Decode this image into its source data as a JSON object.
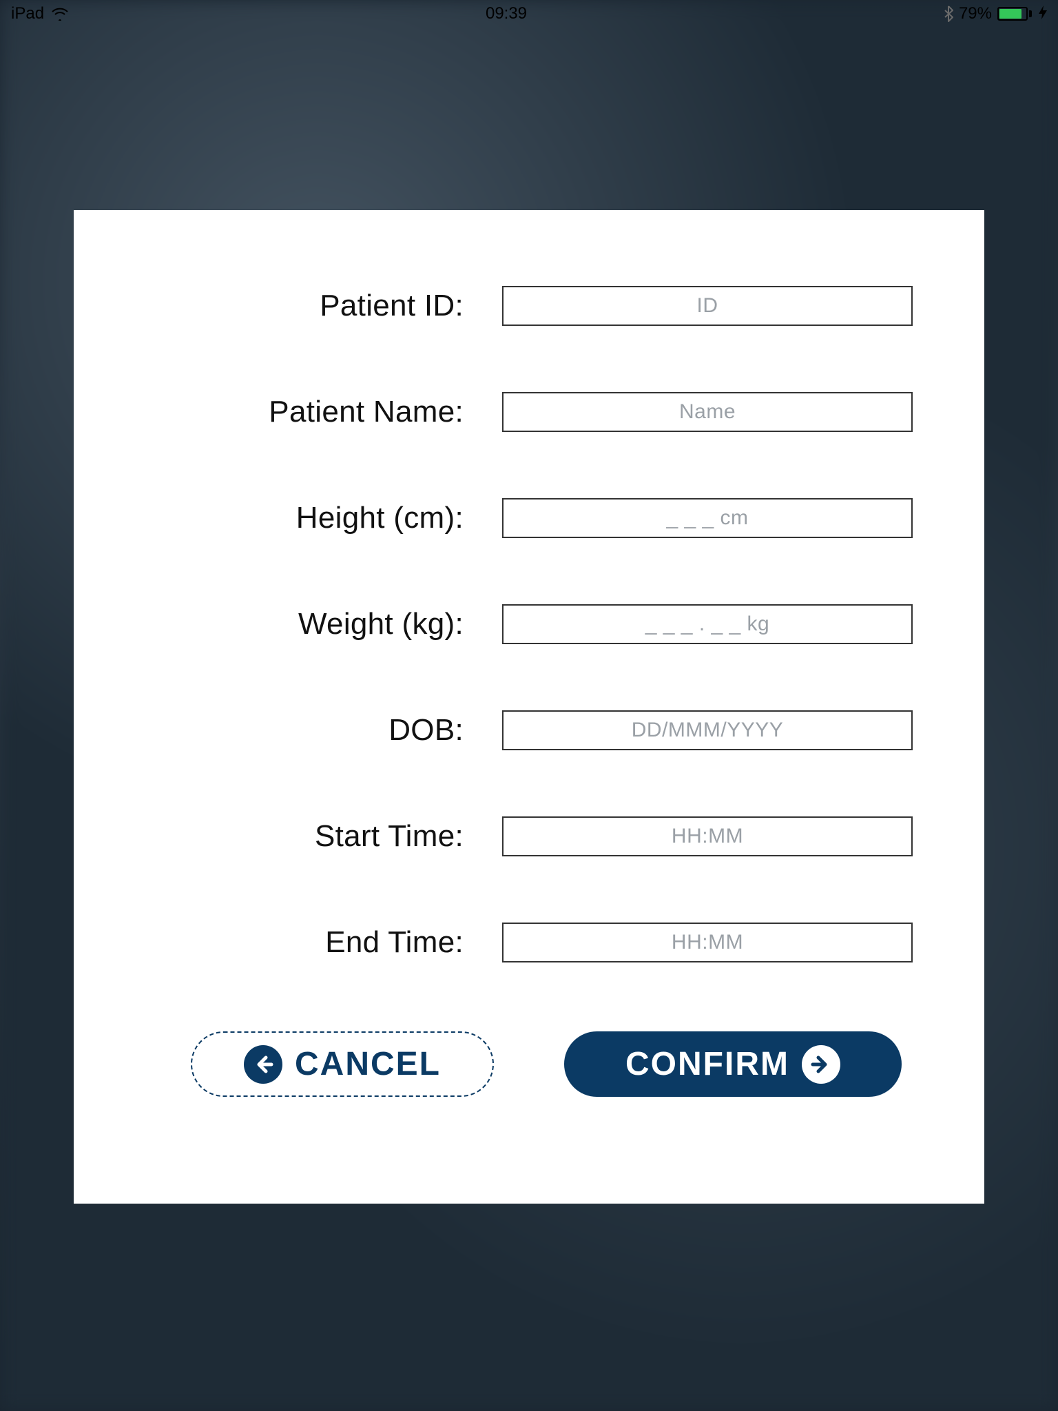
{
  "status_bar": {
    "device": "iPad",
    "time": "09:39",
    "battery_pct": "79%"
  },
  "form": {
    "fields": [
      {
        "label": "Patient ID:",
        "placeholder": "ID"
      },
      {
        "label": "Patient Name:",
        "placeholder": "Name"
      },
      {
        "label": "Height (cm):",
        "placeholder": "_ _ _ cm"
      },
      {
        "label": "Weight (kg):",
        "placeholder": "_ _ _ . _ _ kg"
      },
      {
        "label": "DOB:",
        "placeholder": "DD/MMM/YYYY"
      },
      {
        "label": "Start Time:",
        "placeholder": "HH:MM"
      },
      {
        "label": "End Time:",
        "placeholder": "HH:MM"
      }
    ]
  },
  "buttons": {
    "cancel": "CANCEL",
    "confirm": "CONFIRM"
  },
  "colors": {
    "primary": "#0b3a64",
    "battery_fill": "#34c759"
  }
}
